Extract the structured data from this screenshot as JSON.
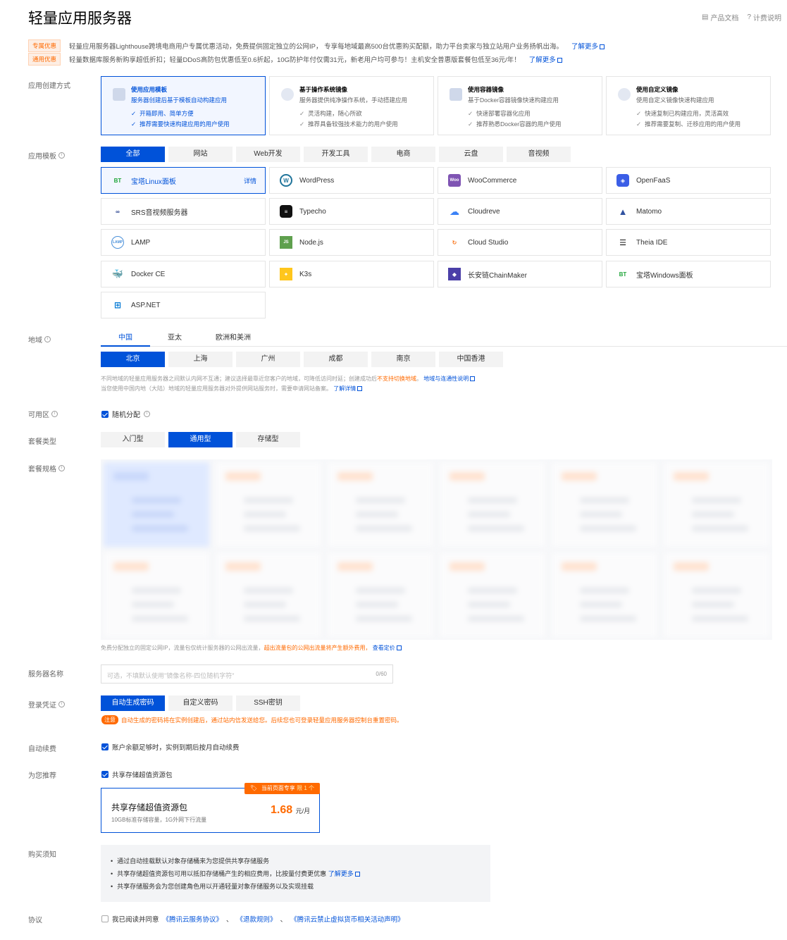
{
  "page": {
    "title": "轻量应用服务器",
    "links": [
      "产品文档",
      "计费说明"
    ]
  },
  "promos": [
    {
      "tag": "专属优惠",
      "text": "轻量应用服务器Lighthouse跨境电商用户专属优惠活动，免费提供固定独立的公网IP， 专享每地域最高500台优惠购买配额，助力平台卖家与独立站用户业务扬帆出海。",
      "link": "了解更多"
    },
    {
      "tag": "通用优惠",
      "text": "轻量数据库服务新购享超低折扣；轻量DDoS高防包优惠低至0.6折起，10G防护年付仅需31元，新老用户均可参与！主机安全普惠版套餐包低至36元/年！",
      "link": "了解更多"
    }
  ],
  "labels": {
    "create_method": "应用创建方式",
    "template": "应用模板",
    "region": "地域",
    "zone": "可用区",
    "plan_type": "套餐类型",
    "plan_spec": "套餐规格",
    "server_name": "服务器名称",
    "credential": "登录凭证",
    "renew": "自动续费",
    "recommend": "为您推荐",
    "notice": "购买须知",
    "agreement": "协议"
  },
  "methods": [
    {
      "title": "使用应用模板",
      "desc": "服务器创建后基于模板自动构建应用",
      "bullets": [
        "开箱即用、简单方便",
        "推荐需要快速构建应用的用户使用"
      ]
    },
    {
      "title": "基于操作系统镜像",
      "desc": "服务器提供纯净操作系统，手动搭建应用",
      "bullets": [
        "灵活构建，随心所欲",
        "推荐具备较强技术能力的用户使用"
      ]
    },
    {
      "title": "使用容器镜像",
      "desc": "基于Docker容器镜像快速构建应用",
      "bullets": [
        "快速部署容器化应用",
        "推荐熟悉Docker容器的用户使用"
      ]
    },
    {
      "title": "使用自定义镜像",
      "desc": "使用自定义镜像快速构建应用",
      "bullets": [
        "快速复制已构建应用，灵活高效",
        "推荐需要复制、迁移应用的用户使用"
      ]
    }
  ],
  "template_tabs": [
    "全部",
    "网站",
    "Web开发",
    "开发工具",
    "电商",
    "云盘",
    "音视频"
  ],
  "apps": [
    {
      "name": "宝塔Linux面板",
      "icon": "bt-icon",
      "detail": "详情"
    },
    {
      "name": "WordPress",
      "icon": "wordpress-icon"
    },
    {
      "name": "WooCommerce",
      "icon": "woocommerce-icon"
    },
    {
      "name": "OpenFaaS",
      "icon": "openfaas-icon"
    },
    {
      "name": "SRS音视频服务器",
      "icon": "srs-icon"
    },
    {
      "name": "Typecho",
      "icon": "typecho-icon"
    },
    {
      "name": "Cloudreve",
      "icon": "cloudreve-icon"
    },
    {
      "name": "Matomo",
      "icon": "matomo-icon"
    },
    {
      "name": "LAMP",
      "icon": "lamp-icon"
    },
    {
      "name": "Node.js",
      "icon": "nodejs-icon"
    },
    {
      "name": "Cloud Studio",
      "icon": "cloud-studio-icon"
    },
    {
      "name": "Theia IDE",
      "icon": "theia-icon"
    },
    {
      "name": "Docker CE",
      "icon": "docker-icon"
    },
    {
      "name": "K3s",
      "icon": "k3s-icon"
    },
    {
      "name": "长安链ChainMaker",
      "icon": "chainmaker-icon"
    },
    {
      "name": "宝塔Windows面板",
      "icon": "bt-windows-icon"
    },
    {
      "name": "ASP.NET",
      "icon": "windows-icon"
    }
  ],
  "region_tabs": [
    "中国",
    "亚太",
    "欧洲和美洲"
  ],
  "cities": [
    "北京",
    "上海",
    "广州",
    "成都",
    "南京",
    "中国香港"
  ],
  "region_note1_a": "不同地域的轻量应用服务器之间默认内网不互通；建议选择最靠近您客户的地域，可降低访问时延；创建成功后",
  "region_note1_b": "不支持切换地域",
  "region_note1_c": "。",
  "region_note1_link": "地域与连通性说明",
  "region_note2": "当您使用中国内地（大陆）地域的轻量应用服务器对外提供网站服务时，需要申请网站备案。",
  "region_note2_link": "了解详情",
  "zone_text": "随机分配",
  "plan_types": [
    "入门型",
    "通用型",
    "存储型"
  ],
  "traffic_note_a": "免费分配独立的固定公网IP，流量包仅统计服务器的公网出流量，",
  "traffic_note_b": "超出流量包的公网出流量将产生额外费用，",
  "traffic_note_link": "查看定价",
  "server_name_placeholder": "可选，不填默认使用\"镜像名称-四位随机字符\"",
  "server_name_count": "0/60",
  "credentials": [
    "自动生成密码",
    "自定义密码",
    "SSH密钥"
  ],
  "credential_tag": "注意",
  "credential_note": "自动生成的密码将在实例创建后，通过站内信发送给您。后续您也可登录轻量应用服务器控制台重置密码。",
  "renew_text": "账户余额足够时，实例到期后按月自动续费",
  "recommend_text": "共享存储超值资源包",
  "package": {
    "badge": "当前页面专享",
    "badge_limit": "限 1 个",
    "title": "共享存储超值资源包",
    "desc": "10GB标准存储容量，1G外网下行流量",
    "price": "1.68",
    "unit": "元/月"
  },
  "notices": [
    "通过自动挂载默认对象存储桶来为您提供共享存储服务",
    "共享存储超值资源包可用以抵扣存储桶产生的相应费用，比按量付费更优惠",
    "共享存储服务会为您创建角色用以开通轻量对象存储服务以及实现挂载"
  ],
  "notice_link": "了解更多",
  "agreement_prefix": "我已阅读并同意",
  "agreement_links": [
    "《腾讯云服务协议》",
    "《退款规则》",
    "《腾讯云禁止虚拟货币相关活动声明》"
  ],
  "agreement_sep": "、"
}
